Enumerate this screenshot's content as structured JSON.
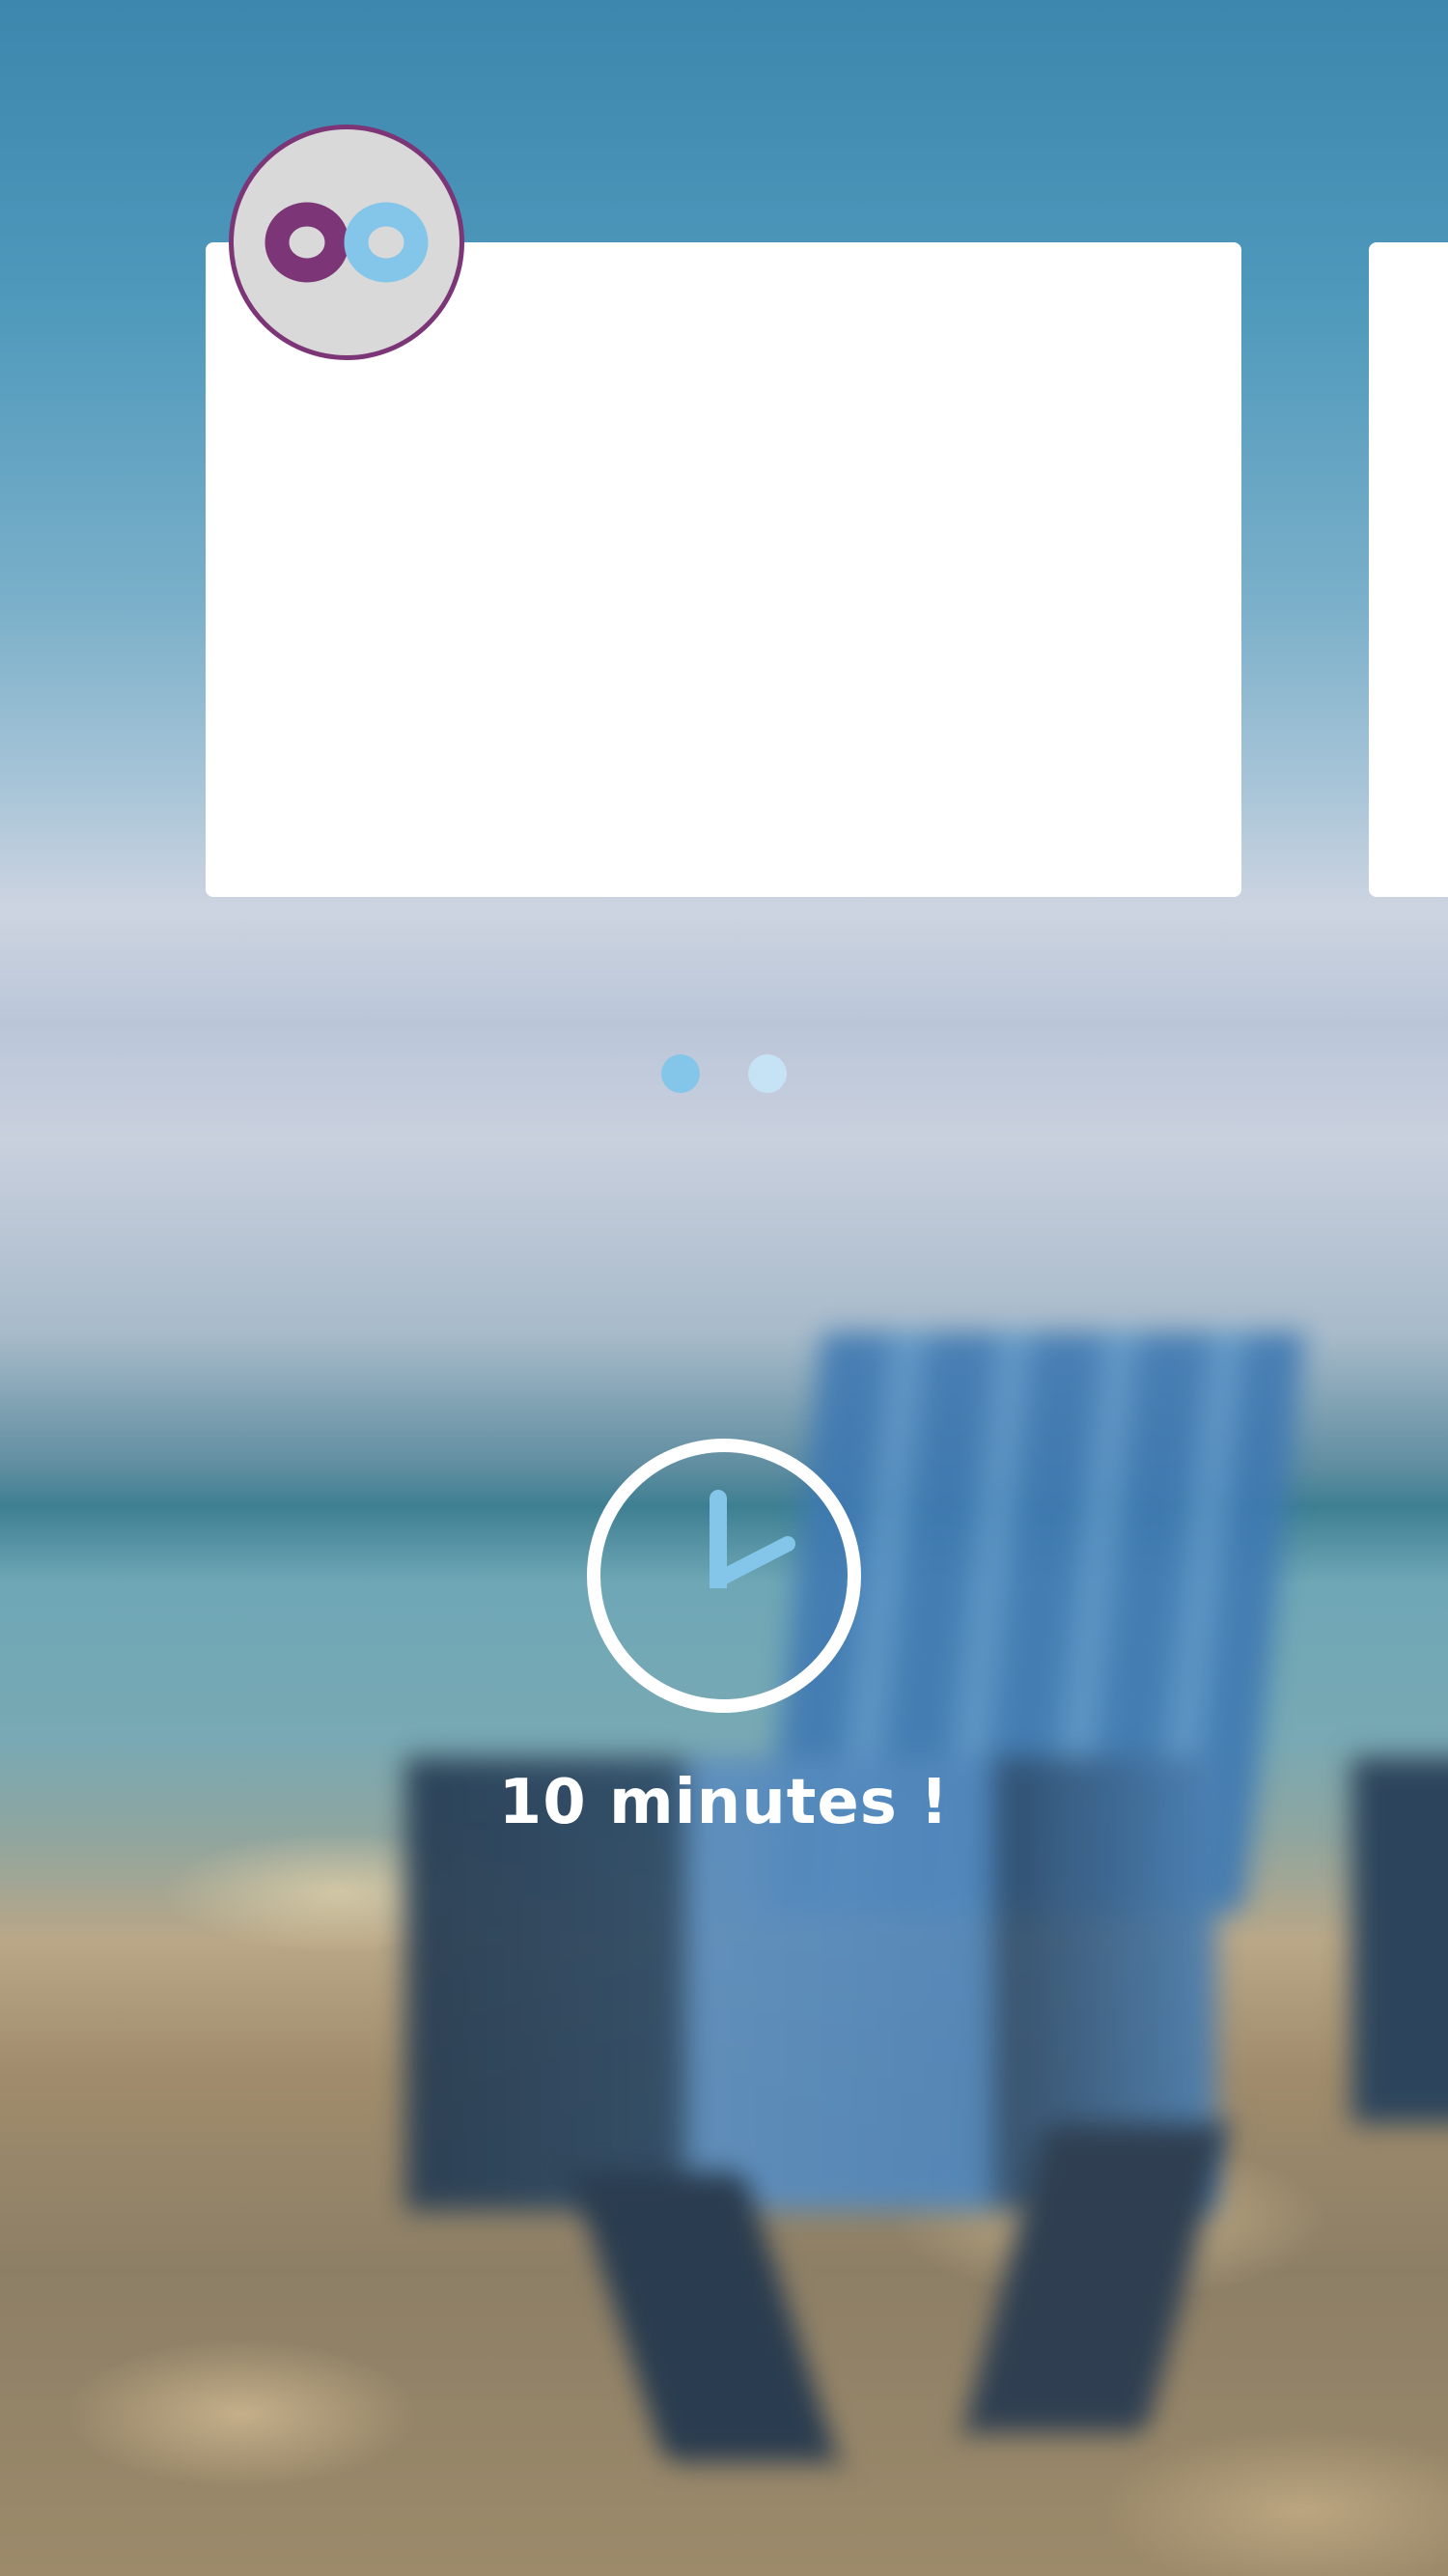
{
  "logo": {
    "letters": [
      "o",
      "o"
    ],
    "icon": "brand-logo-oo",
    "colors": {
      "first": "#7c3577",
      "second": "#84c6ea",
      "ring": "#7c3577",
      "fill": "#d9d9d9"
    }
  },
  "carousel": {
    "page_count": 2,
    "active_index": 0,
    "colors": {
      "active": "#84c6ea",
      "inactive": "#c6e3f5"
    }
  },
  "timer": {
    "icon": "clock-icon",
    "label": "10 minutes !",
    "colors": {
      "ring": "#ffffff",
      "hands": "#84c6ea"
    }
  },
  "background": {
    "description_icon": "beach-chair-photo"
  }
}
